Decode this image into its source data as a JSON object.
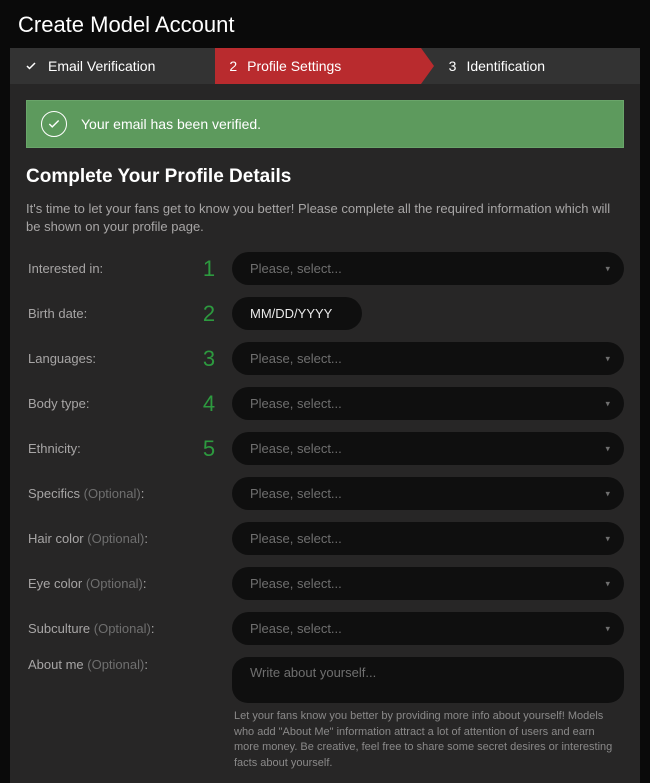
{
  "header": {
    "title": "Create Model Account"
  },
  "stepper": {
    "steps": [
      {
        "label": "Email Verification",
        "done": true
      },
      {
        "num": "2",
        "label": "Profile Settings",
        "active": true
      },
      {
        "num": "3",
        "label": "Identification"
      }
    ]
  },
  "alert": {
    "text": "Your email has been verified."
  },
  "section": {
    "title": "Complete Your Profile Details",
    "desc": "It's time to let your fans get to know you better! Please complete all the required information which will be shown on your profile page."
  },
  "form": {
    "placeholder_select": "Please, select...",
    "interested_label": "Interested in:",
    "birth_label": "Birth date:",
    "birth_placeholder": "MM/DD/YYYY",
    "languages_label": "Languages:",
    "body_label": "Body type:",
    "ethnicity_label": "Ethnicity:",
    "optional": "(Optional)",
    "specifics_label": "Specifics ",
    "hair_label": "Hair color ",
    "eye_label": "Eye color ",
    "subculture_label": "Subculture ",
    "about_label": "About me ",
    "about_placeholder": "Write about yourself...",
    "about_hint": "Let your fans know you better by providing more info about yourself! Models who add \"About Me\" information attract a lot of attention of users and earn more money. Be creative, feel free to share some secret desires or interesting facts about yourself.",
    "nums": {
      "r1": "1",
      "r2": "2",
      "r3": "3",
      "r4": "4",
      "r5": "5"
    }
  }
}
